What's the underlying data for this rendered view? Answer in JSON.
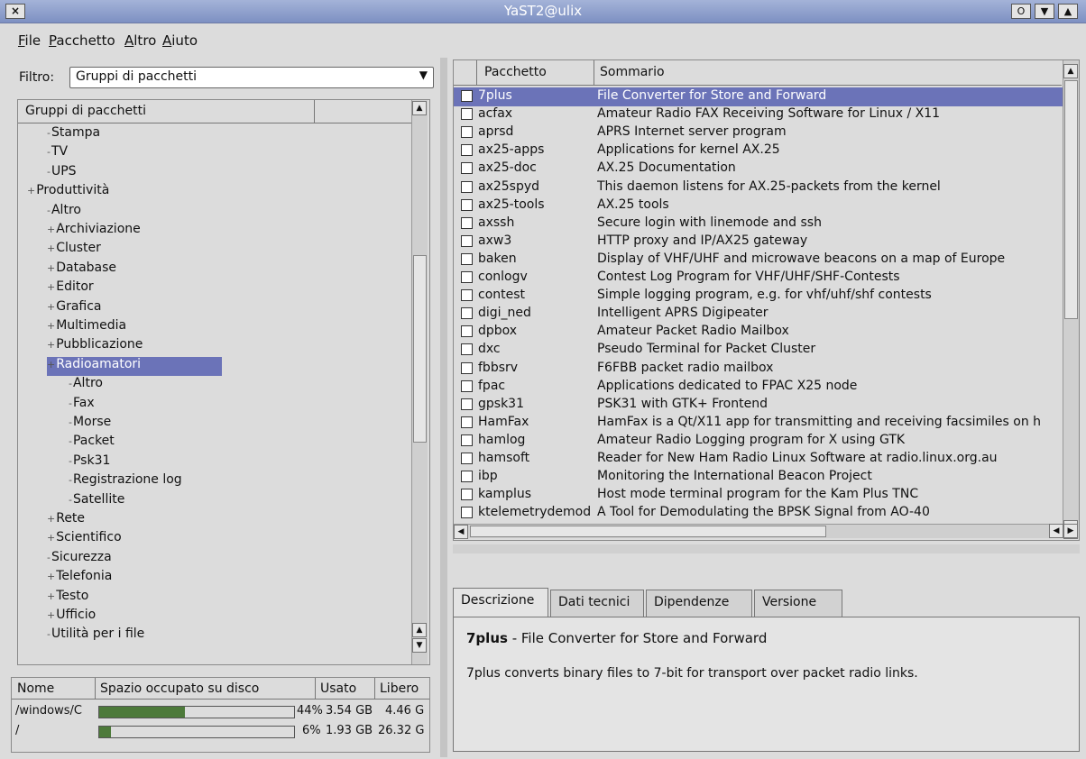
{
  "window": {
    "title": "YaST2@ulix",
    "close_glyph": "×",
    "buttons": [
      "O",
      "▼",
      "▲"
    ]
  },
  "menubar": {
    "items": [
      {
        "underline": "F",
        "rest": "ile"
      },
      {
        "underline": "P",
        "rest": "acchetto"
      },
      {
        "underline": "A",
        "rest": "ltro"
      },
      {
        "underline": "A",
        "rest": "iuto"
      }
    ]
  },
  "filter": {
    "label": "Filtro:",
    "value": "Gruppi di pacchetti"
  },
  "tree": {
    "header": "Gruppi di pacchetti",
    "rows": [
      {
        "label": "Stampa",
        "level": 2,
        "expander": false
      },
      {
        "label": "TV",
        "level": 2,
        "expander": false
      },
      {
        "label": "UPS",
        "level": 2,
        "expander": false
      },
      {
        "label": "Produttività",
        "level": 1,
        "expander": true
      },
      {
        "label": "Altro",
        "level": 2,
        "expander": false
      },
      {
        "label": "Archiviazione",
        "level": 2,
        "expander": true
      },
      {
        "label": "Cluster",
        "level": 2,
        "expander": true
      },
      {
        "label": "Database",
        "level": 2,
        "expander": true
      },
      {
        "label": "Editor",
        "level": 2,
        "expander": true
      },
      {
        "label": "Grafica",
        "level": 2,
        "expander": true
      },
      {
        "label": "Multimedia",
        "level": 2,
        "expander": true
      },
      {
        "label": "Pubblicazione",
        "level": 2,
        "expander": true
      },
      {
        "label": "Radioamatori",
        "level": 2,
        "expander": true,
        "selected": true
      },
      {
        "label": "Altro",
        "level": 3,
        "expander": false
      },
      {
        "label": "Fax",
        "level": 3,
        "expander": false
      },
      {
        "label": "Morse",
        "level": 3,
        "expander": false
      },
      {
        "label": "Packet",
        "level": 3,
        "expander": false
      },
      {
        "label": "Psk31",
        "level": 3,
        "expander": false
      },
      {
        "label": "Registrazione log",
        "level": 3,
        "expander": false
      },
      {
        "label": "Satellite",
        "level": 3,
        "expander": false
      },
      {
        "label": "Rete",
        "level": 2,
        "expander": true
      },
      {
        "label": "Scientifico",
        "level": 2,
        "expander": true
      },
      {
        "label": "Sicurezza",
        "level": 2,
        "expander": false
      },
      {
        "label": "Telefonia",
        "level": 2,
        "expander": true
      },
      {
        "label": "Testo",
        "level": 2,
        "expander": true
      },
      {
        "label": "Ufficio",
        "level": 2,
        "expander": true
      },
      {
        "label": "Utilità per i file",
        "level": 2,
        "expander": false
      }
    ]
  },
  "disk": {
    "headers": [
      "Nome",
      "Spazio occupato su disco",
      "Usato",
      "Libero"
    ],
    "rows": [
      {
        "name": "/windows/C",
        "percent": "44%",
        "fraction": 0.44,
        "used": "3.54 GB",
        "free": "4.46 G"
      },
      {
        "name": "/",
        "percent": "6%",
        "fraction": 0.06,
        "used": "1.93 GB",
        "free": "26.32 G"
      }
    ]
  },
  "packages": {
    "headers": [
      "Pacchetto",
      "Sommario"
    ],
    "rows": [
      {
        "name": "7plus",
        "summary": "File Converter for Store and Forward",
        "selected": true
      },
      {
        "name": "acfax",
        "summary": "Amateur Radio FAX Receiving Software for Linux / X11"
      },
      {
        "name": "aprsd",
        "summary": "APRS Internet server program"
      },
      {
        "name": "ax25-apps",
        "summary": "Applications for kernel AX.25"
      },
      {
        "name": "ax25-doc",
        "summary": "AX.25 Documentation"
      },
      {
        "name": "ax25spyd",
        "summary": "This daemon listens for AX.25-packets from the kernel"
      },
      {
        "name": "ax25-tools",
        "summary": "AX.25 tools"
      },
      {
        "name": "axssh",
        "summary": "Secure login with linemode and ssh"
      },
      {
        "name": "axw3",
        "summary": "HTTP proxy and IP/AX25 gateway"
      },
      {
        "name": "baken",
        "summary": "Display of VHF/UHF and microwave beacons on a map of Europe"
      },
      {
        "name": "conlogv",
        "summary": "Contest Log Program for VHF/UHF/SHF-Contests"
      },
      {
        "name": "contest",
        "summary": "Simple logging program, e.g. for vhf/uhf/shf contests"
      },
      {
        "name": "digi_ned",
        "summary": "Intelligent APRS Digipeater"
      },
      {
        "name": "dpbox",
        "summary": "Amateur Packet Radio Mailbox"
      },
      {
        "name": "dxc",
        "summary": "Pseudo Terminal for Packet Cluster"
      },
      {
        "name": "fbbsrv",
        "summary": "F6FBB packet radio mailbox"
      },
      {
        "name": "fpac",
        "summary": "Applications dedicated to FPAC X25 node"
      },
      {
        "name": "gpsk31",
        "summary": "PSK31 with GTK+ Frontend"
      },
      {
        "name": "HamFax",
        "summary": "HamFax is a Qt/X11 app for transmitting and receiving facsimiles on h"
      },
      {
        "name": "hamlog",
        "summary": "Amateur Radio Logging program for X using GTK"
      },
      {
        "name": "hamsoft",
        "summary": "Reader for New Ham Radio Linux Software at radio.linux.org.au"
      },
      {
        "name": "ibp",
        "summary": "Monitoring the International Beacon Project"
      },
      {
        "name": "kamplus",
        "summary": "Host mode terminal program for the Kam Plus TNC"
      },
      {
        "name": "ktelemetrydemod",
        "summary": "A Tool for Demodulating the BPSK Signal from AO-40"
      }
    ]
  },
  "tabs": {
    "items": [
      {
        "underline": "",
        "label": "Descrizione",
        "active": true
      },
      {
        "underline": "",
        "label": "Dati tecnici"
      },
      {
        "underline": "",
        "label": "Dipendenze"
      },
      {
        "underline": "",
        "label": "Versione"
      }
    ]
  },
  "description": {
    "name": "7plus",
    "dash": " - ",
    "title": "File Converter for Store and Forward",
    "text": "7plus converts binary files to 7-bit for transport over packet radio links."
  }
}
